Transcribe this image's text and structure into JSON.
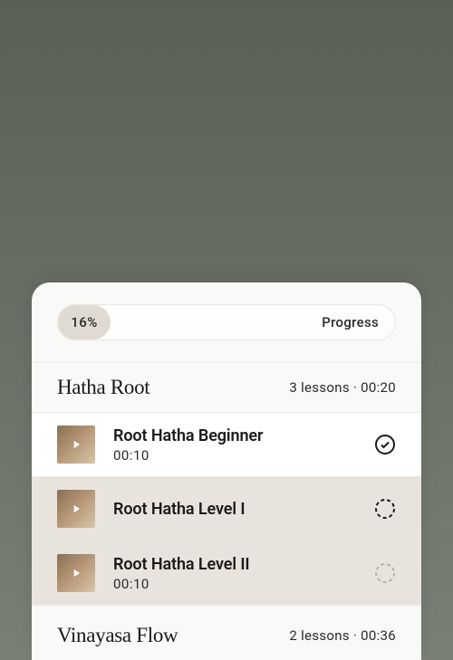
{
  "progress": {
    "percent": "16%",
    "label": "Progress"
  },
  "sections": [
    {
      "title": "Hatha Root",
      "meta": "3 lessons · 00:20",
      "lessons": [
        {
          "title": "Root Hatha Beginner",
          "duration": "00:10"
        },
        {
          "title": "Root Hatha Level I",
          "duration": ""
        },
        {
          "title": "Root Hatha Level II",
          "duration": "00:10"
        }
      ]
    },
    {
      "title": "Vinayasa Flow",
      "meta": "2 lessons · 00:36"
    }
  ]
}
